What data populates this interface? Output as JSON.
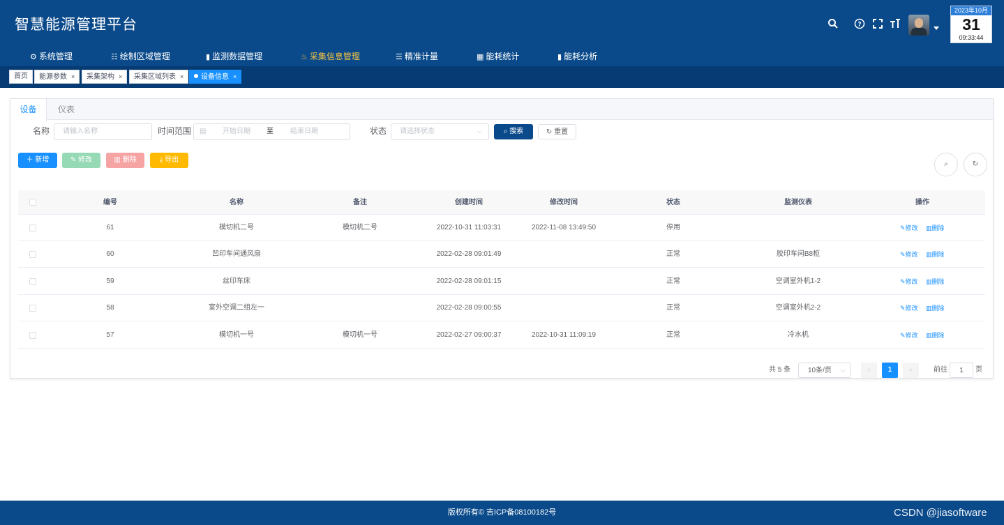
{
  "header": {
    "title": "智慧能源管理平台",
    "icons": [
      "search-icon",
      "help-icon",
      "fullscreen-icon",
      "font-size-icon"
    ],
    "calendar": {
      "month": "2023年10月",
      "day": "31",
      "time": "09:33:44"
    }
  },
  "nav": {
    "items": [
      {
        "label": "系统管理",
        "icon": "gear-icon"
      },
      {
        "label": "绘制区域管理",
        "icon": "list-icon"
      },
      {
        "label": "监测数据管理",
        "icon": "bar-chart-icon"
      },
      {
        "label": "采集信息管理",
        "icon": "flame-icon",
        "active": true
      },
      {
        "label": "精准计量",
        "icon": "sliders-icon"
      },
      {
        "label": "能耗统计",
        "icon": "calculator-icon"
      },
      {
        "label": "能耗分析",
        "icon": "bar-chart-icon"
      }
    ]
  },
  "tags": [
    {
      "label": "首页",
      "closable": false
    },
    {
      "label": "能源参数",
      "closable": true
    },
    {
      "label": "采集架构",
      "closable": true
    },
    {
      "label": "采集区域列表",
      "closable": true
    },
    {
      "label": "设备信息",
      "closable": true,
      "active": true
    }
  ],
  "tabs": [
    {
      "label": "设备",
      "active": true
    },
    {
      "label": "仪表"
    }
  ],
  "search": {
    "name_label": "名称",
    "name_placeholder": "请输入名称",
    "time_label": "时间范围",
    "start_placeholder": "开始日期",
    "range_sep": "至",
    "end_placeholder": "结束日期",
    "status_label": "状态",
    "status_placeholder": "请选择状态",
    "search_btn": "搜索",
    "reset_btn": "重置"
  },
  "toolbar": {
    "add": "新增",
    "edit": "修改",
    "delete": "删除",
    "export": "导出"
  },
  "table": {
    "columns": [
      "编号",
      "名称",
      "备注",
      "创建时间",
      "修改时间",
      "状态",
      "监测仪表",
      "操作"
    ],
    "rows": [
      {
        "id": "61",
        "name": "模切机二号",
        "remark": "模切机二号",
        "created": "2022-10-31 11:03:31",
        "modified": "2022-11-08 13:49:50",
        "status": "停用",
        "meter": ""
      },
      {
        "id": "60",
        "name": "凹印车间通风扇",
        "remark": "",
        "created": "2022-02-28 09:01:49",
        "modified": "",
        "status": "正常",
        "meter": "胶印车间B8柜"
      },
      {
        "id": "59",
        "name": "丝印车床",
        "remark": "",
        "created": "2022-02-28 09:01:15",
        "modified": "",
        "status": "正常",
        "meter": "空调室外机1-2"
      },
      {
        "id": "58",
        "name": "室外空调二组左一",
        "remark": "",
        "created": "2022-02-28 09:00:55",
        "modified": "",
        "status": "正常",
        "meter": "空调室外机2-2"
      },
      {
        "id": "57",
        "name": "模切机一号",
        "remark": "模切机一号",
        "created": "2022-02-27 09:00:37",
        "modified": "2022-10-31 11:09:19",
        "status": "正常",
        "meter": "冷水机"
      }
    ],
    "op_edit": "修改",
    "op_delete": "删除"
  },
  "pagination": {
    "total": "共 5 条",
    "page_size": "10条/页",
    "current": "1",
    "goto_prefix": "前往",
    "goto_value": "1",
    "goto_suffix": "页"
  },
  "footer": {
    "copyright": "版权所有© 吉ICP备08100182号",
    "watermark": "CSDN @jiasoftware"
  },
  "colors": {
    "header": "#0a4a8a",
    "primary": "#1890ff",
    "success": "#95d9b5",
    "danger": "#f6a3a3",
    "warning": "#ffba00",
    "nav_active": "#f5c242"
  }
}
